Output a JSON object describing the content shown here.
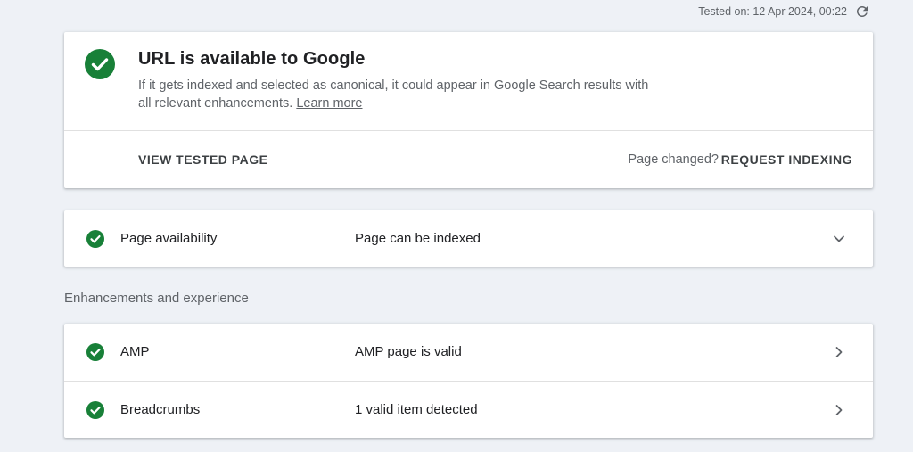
{
  "header": {
    "tested_on": "Tested on: 12 Apr 2024, 00:22",
    "refresh_icon": "refresh-icon"
  },
  "summary": {
    "title": "URL is available to Google",
    "description": "If it gets indexed and selected as canonical, it could appear in Google Search results with all relevant enhancements.",
    "learn_more": "Learn more",
    "view_tested_page": "VIEW TESTED PAGE",
    "page_changed": "Page changed?",
    "request_indexing": "REQUEST INDEXING",
    "status_icon": "check-circle-icon"
  },
  "availability": {
    "label": "Page availability",
    "status": "Page can be indexed",
    "icon": "check-circle-icon",
    "toggle_icon": "chevron-down-icon"
  },
  "enhancements": {
    "heading": "Enhancements and experience",
    "items": [
      {
        "label": "AMP",
        "status": "AMP page is valid",
        "icon": "check-circle-icon",
        "nav_icon": "chevron-right-icon"
      },
      {
        "label": "Breadcrumbs",
        "status": "1 valid item detected",
        "icon": "check-circle-icon",
        "nav_icon": "chevron-right-icon"
      }
    ]
  },
  "colors": {
    "success_green": "#188038",
    "background": "#eef1f6",
    "card": "#ffffff",
    "text_primary": "#202124",
    "text_secondary": "#5f6368"
  }
}
